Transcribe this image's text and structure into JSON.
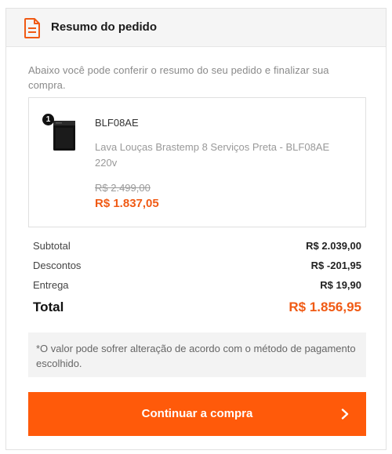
{
  "header": {
    "title": "Resumo do pedido",
    "icon": "document-icon"
  },
  "intro_text": "Abaixo você pode conferir o resumo do seu pedido e finalizar sua compra.",
  "product": {
    "quantity": "1",
    "sku": "BLF08AE",
    "name": "Lava Louças Brastemp 8 Serviços Preta - BLF08AE 220v",
    "old_price": "R$ 2.499,00",
    "price": "R$ 1.837,05",
    "image": "dishwasher-image"
  },
  "summary": {
    "subtotal_label": "Subtotal",
    "subtotal_value": "R$ 2.039,00",
    "discount_label": "Descontos",
    "discount_value": "R$ -201,95",
    "delivery_label": "Entrega",
    "delivery_value": "R$ 19,90",
    "total_label": "Total",
    "total_value": "R$ 1.856,95"
  },
  "notice_text": "*O valor pode sofrer alteração de acordo com o método de pagamento escolhido.",
  "continue_button": {
    "label": "Continuar a compra",
    "icon": "chevron-right-icon"
  },
  "colors": {
    "accent": "#ff5a0a",
    "price": "#f05a14",
    "header_bg": "#f5f5f5",
    "notice_bg": "#f3f3f3"
  }
}
